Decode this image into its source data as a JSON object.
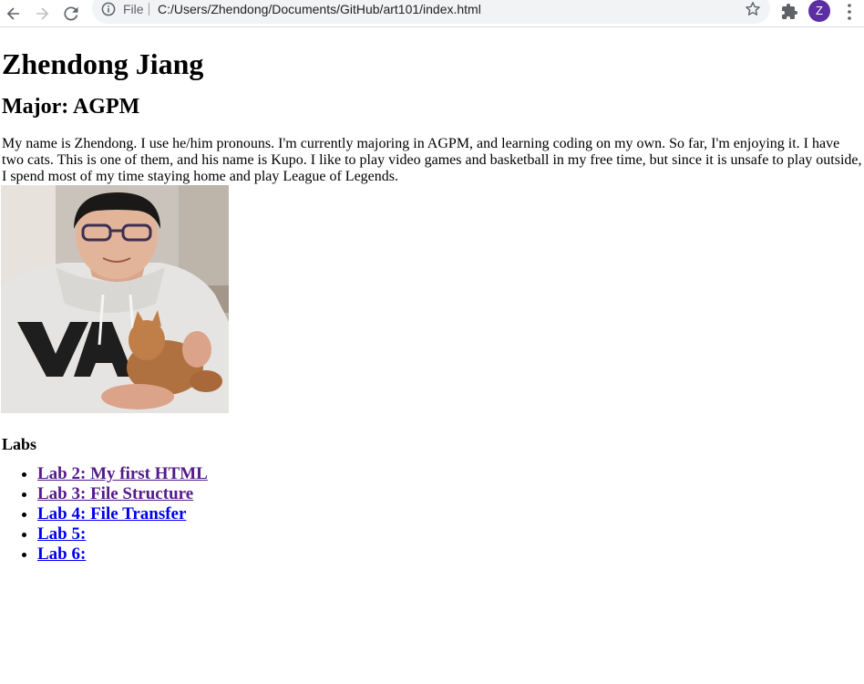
{
  "browser": {
    "scheme_label": "File",
    "url": "C:/Users/Zhendong/Documents/GitHub/art101/index.html",
    "profile_initial": "Z",
    "icons": [
      "back-icon",
      "forward-icon",
      "reload-icon",
      "info-icon",
      "star-icon",
      "extensions-icon",
      "more-menu-icon"
    ],
    "colors": {
      "avatar": "#5b2fa3",
      "omnibox_bg": "#f1f3f4"
    }
  },
  "page": {
    "title": "Zhendong Jiang",
    "subtitle": "Major: AGPM",
    "bio": "My name is Zhendong. I use he/him pronouns. I'm currently majoring in AGPM, and learning coding on my own. So far, I'm enjoying it. I have two cats. This is one of them, and his name is Kupo. I like to play video games and basketball in my free time, but since it is unsafe to play outside, I spend most of my time staying home and play League of Legends.",
    "labs_heading": "Labs",
    "labs": [
      {
        "label": "Lab 2: My first HTML",
        "visited": true
      },
      {
        "label": "Lab 3: File Structure",
        "visited": true
      },
      {
        "label": "Lab 4: File Transfer",
        "visited": false
      },
      {
        "label": "Lab 5:",
        "visited": false
      },
      {
        "label": "Lab 6:",
        "visited": false
      }
    ],
    "colors": {
      "link_visited": "#551a8b",
      "link_unvisited": "#0000ee"
    }
  }
}
